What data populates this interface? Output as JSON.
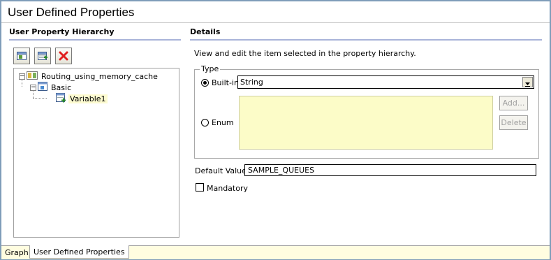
{
  "page": {
    "title": "User Defined Properties"
  },
  "left_panel": {
    "heading": "User Property Hierarchy",
    "toolbar": [
      {
        "name": "add-group-icon"
      },
      {
        "name": "add-property-icon"
      },
      {
        "name": "delete-icon"
      }
    ],
    "tree": {
      "root": {
        "label": "Routing_using_memory_cache",
        "expanded": true
      },
      "group": {
        "label": "Basic",
        "expanded": true
      },
      "item": {
        "label": "Variable1",
        "selected": true
      }
    }
  },
  "details": {
    "heading": "Details",
    "description": "View and edit the item selected in the property hierarchy.",
    "type_group": {
      "legend": "Type",
      "builtin_label": "Built-in",
      "builtin_selected": true,
      "builtin_value": "String",
      "enum_label": "Enum",
      "enum_selected": false,
      "add_button": "Add...",
      "delete_button": "Delete"
    },
    "default_value": {
      "label": "Default Value",
      "value": "SAMPLE_QUEUES"
    },
    "mandatory": {
      "label": "Mandatory",
      "checked": false
    }
  },
  "tabs": [
    {
      "label": "Graph",
      "active": false
    },
    {
      "label": "User Defined Properties",
      "active": true
    }
  ],
  "colors": {
    "accent_rule": "#a9b4d9",
    "enum_bg": "#fcfcc8",
    "tab_strip": "#fffde0",
    "delete_red": "#e02020"
  }
}
